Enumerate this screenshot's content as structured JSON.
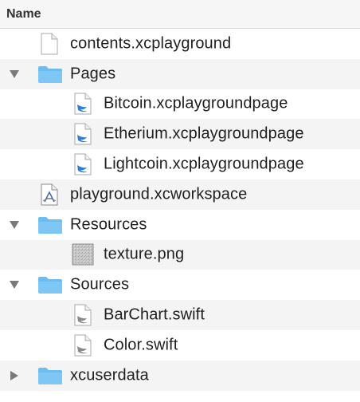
{
  "header": {
    "name_label": "Name"
  },
  "rows": [
    {
      "label": "contents.xcplayground"
    },
    {
      "label": "Pages"
    },
    {
      "label": "Bitcoin.xcplaygroundpage"
    },
    {
      "label": "Etherium.xcplaygroundpage"
    },
    {
      "label": "Lightcoin.xcplaygroundpage"
    },
    {
      "label": "playground.xcworkspace"
    },
    {
      "label": "Resources"
    },
    {
      "label": "texture.png"
    },
    {
      "label": "Sources"
    },
    {
      "label": "BarChart.swift"
    },
    {
      "label": "Color.swift"
    },
    {
      "label": "xcuserdata"
    }
  ],
  "colors": {
    "folder": "#6cbcf0",
    "swift_icon": "#2f7fd6",
    "alt_row": "#f4f4f4"
  }
}
